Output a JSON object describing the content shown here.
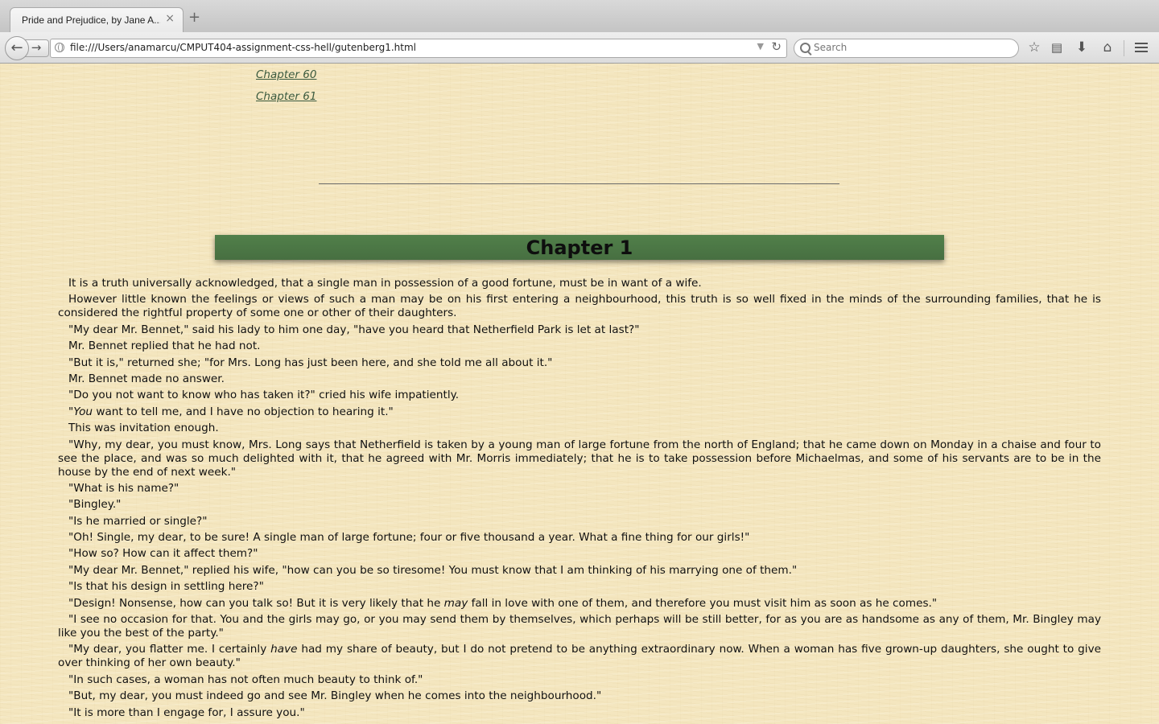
{
  "browser": {
    "tab_title": "Pride and Prejudice, by Jane A...",
    "tab_close": "×",
    "new_tab": "+",
    "url": "file:///Users/anamarcu/CMPUT404-assignment-css-hell/gutenberg1.html",
    "search_placeholder": "Search",
    "toolbar_icons": [
      "back-icon",
      "forward-icon",
      "reload-icon",
      "search-icon",
      "bookmark-star-icon",
      "reading-list-icon",
      "download-icon",
      "home-icon",
      "menu-icon"
    ]
  },
  "toc": {
    "links": [
      "Chapter 60",
      "Chapter 61"
    ]
  },
  "chapter": {
    "title": "Chapter 1",
    "paragraphs": [
      "It is a truth universally acknowledged, that a single man in possession of a good fortune, must be in want of a wife.",
      "However little known the feelings or views of such a man may be on his first entering a neighbourhood, this truth is so well fixed in the minds of the surrounding families, that he is considered the rightful property of some one or other of their daughters.",
      "\"My dear Mr. Bennet,\" said his lady to him one day, \"have you heard that Netherfield Park is let at last?\"",
      "Mr. Bennet replied that he had not.",
      "\"But it is,\" returned she; \"for Mrs. Long has just been here, and she told me all about it.\"",
      "Mr. Bennet made no answer.",
      "\"Do you not want to know who has taken it?\" cried his wife impatiently.",
      {
        "before": "\"",
        "em": "You",
        "after": " want to tell me, and I have no objection to hearing it.\""
      },
      "This was invitation enough.",
      "\"Why, my dear, you must know, Mrs. Long says that Netherfield is taken by a young man of large fortune from the north of England; that he came down on Monday in a chaise and four to see the place, and was so much delighted with it, that he agreed with Mr. Morris immediately; that he is to take possession before Michaelmas, and some of his servants are to be in the house by the end of next week.\"",
      "\"What is his name?\"",
      "\"Bingley.\"",
      "\"Is he married or single?\"",
      "\"Oh! Single, my dear, to be sure! A single man of large fortune; four or five thousand a year. What a fine thing for our girls!\"",
      "\"How so? How can it affect them?\"",
      "\"My dear Mr. Bennet,\" replied his wife, \"how can you be so tiresome! You must know that I am thinking of his marrying one of them.\"",
      "\"Is that his design in settling here?\"",
      {
        "before": "\"Design! Nonsense, how can you talk so! But it is very likely that he ",
        "em": "may",
        "after": " fall in love with one of them, and therefore you must visit him as soon as he comes.\""
      },
      "\"I see no occasion for that. You and the girls may go, or you may send them by themselves, which perhaps will be still better, for as you are as handsome as any of them, Mr. Bingley may like you the best of the party.\"",
      {
        "before": "\"My dear, you flatter me. I certainly ",
        "em": "have",
        "after": " had my share of beauty, but I do not pretend to be anything extraordinary now. When a woman has five grown-up daughters, she ought to give over thinking of her own beauty.\""
      },
      "\"In such cases, a woman has not often much beauty to think of.\"",
      "\"But, my dear, you must indeed go and see Mr. Bingley when he comes into the neighbourhood.\"",
      "\"It is more than I engage for, I assure you.\""
    ]
  }
}
